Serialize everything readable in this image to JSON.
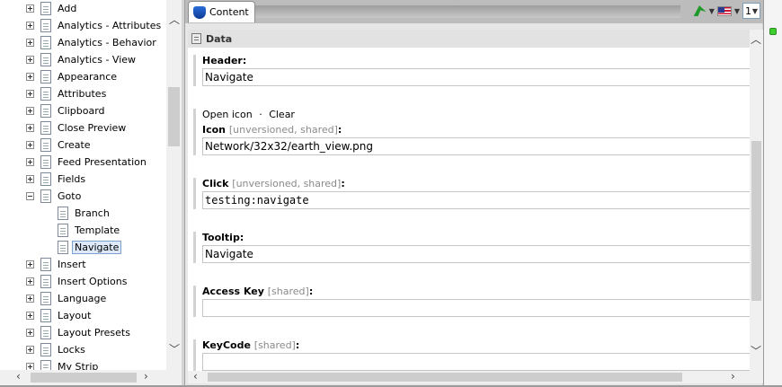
{
  "tree": {
    "items": [
      {
        "label": "Add",
        "expander": "plus",
        "depth": 0
      },
      {
        "label": "Analytics - Attributes",
        "expander": "plus",
        "depth": 0
      },
      {
        "label": "Analytics - Behavior",
        "expander": "plus",
        "depth": 0
      },
      {
        "label": "Analytics - View",
        "expander": "plus",
        "depth": 0
      },
      {
        "label": "Appearance",
        "expander": "plus",
        "depth": 0
      },
      {
        "label": "Attributes",
        "expander": "plus",
        "depth": 0
      },
      {
        "label": "Clipboard",
        "expander": "plus",
        "depth": 0
      },
      {
        "label": "Close Preview",
        "expander": "plus",
        "depth": 0
      },
      {
        "label": "Create",
        "expander": "plus",
        "depth": 0
      },
      {
        "label": "Feed Presentation",
        "expander": "plus",
        "depth": 0
      },
      {
        "label": "Fields",
        "expander": "plus",
        "depth": 0
      },
      {
        "label": "Goto",
        "expander": "minus",
        "depth": 0
      },
      {
        "label": "Branch",
        "expander": "none",
        "depth": 1
      },
      {
        "label": "Template",
        "expander": "none",
        "depth": 1
      },
      {
        "label": "Navigate",
        "expander": "none",
        "depth": 1,
        "selected": true
      },
      {
        "label": "Insert",
        "expander": "plus",
        "depth": 0
      },
      {
        "label": "Insert Options",
        "expander": "plus",
        "depth": 0
      },
      {
        "label": "Language",
        "expander": "plus",
        "depth": 0
      },
      {
        "label": "Layout",
        "expander": "plus",
        "depth": 0
      },
      {
        "label": "Layout Presets",
        "expander": "plus",
        "depth": 0
      },
      {
        "label": "Locks",
        "expander": "plus",
        "depth": 0
      },
      {
        "label": "My Strip",
        "expander": "plus",
        "depth": 0
      }
    ]
  },
  "tabs": {
    "content_label": "Content"
  },
  "toolbar": {
    "version_number": "1",
    "icons": [
      "navigate-icon",
      "flag-us-icon"
    ]
  },
  "section": {
    "title": "Data"
  },
  "fields": {
    "header": {
      "label": "Header:",
      "value": "Navigate"
    },
    "icon": {
      "open_icon_link": "Open icon",
      "separator": "·",
      "clear_link": "Clear",
      "label": "Icon",
      "meta": "[unversioned, shared]",
      "colon": ":",
      "value": "Network/32x32/earth_view.png"
    },
    "click": {
      "label": "Click",
      "meta": "[unversioned, shared]",
      "colon": ":",
      "value": "testing:navigate"
    },
    "tooltip": {
      "label": "Tooltip:",
      "value": "Navigate"
    },
    "access_key": {
      "label": "Access Key",
      "meta": "[shared]",
      "colon": ":",
      "value": ""
    },
    "keycode": {
      "label": "KeyCode",
      "meta": "[shared]",
      "colon": ":",
      "value": ""
    }
  },
  "colors": {
    "accent_selection": "#dde9f8",
    "status_green": "#3ecf2f"
  }
}
